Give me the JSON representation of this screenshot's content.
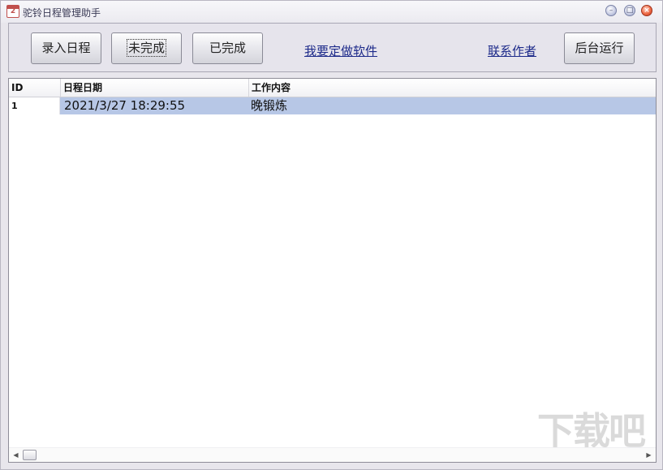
{
  "window": {
    "title": "驼铃日程管理助手",
    "icon_glyph": "2",
    "controls": {
      "minimize": "–",
      "maximize": "□",
      "close": "×"
    }
  },
  "toolbar": {
    "add_schedule": "录入日程",
    "incomplete": "未完成",
    "completed": "已完成",
    "custom_software_link": "我要定做软件",
    "contact_author_link": "联系作者",
    "run_background": "后台运行"
  },
  "table": {
    "columns": [
      "ID",
      "日程日期",
      "工作内容"
    ],
    "rows": [
      {
        "id": "1",
        "date": "2021/3/27 18:29:55",
        "content": "晚锻炼"
      }
    ]
  },
  "scrollbar": {
    "left_arrow": "◀",
    "right_arrow": "▶"
  },
  "watermark": "下载吧",
  "colors": {
    "selection": "#b7c7e6",
    "link": "#1d2a8a",
    "close_button": "#ee6b47"
  }
}
